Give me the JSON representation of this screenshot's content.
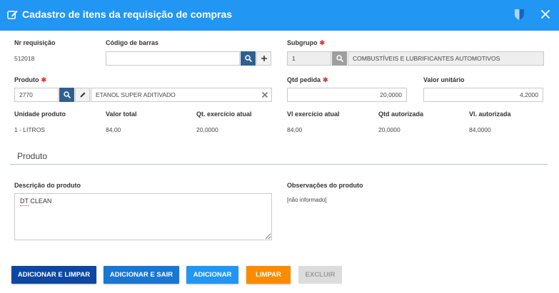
{
  "header": {
    "title": "Cadastro de itens da requisição de compras"
  },
  "form": {
    "nr_requisicao": {
      "label": "Nr requisição",
      "value": "512018"
    },
    "codigo_barras": {
      "label": "Código de barras",
      "value": ""
    },
    "subgrupo": {
      "label": "Subgrupo",
      "required": "✱",
      "code": "1",
      "description": "COMBUSTÍVEIS E LUBRIFICANTES AUTOMOTIVOS"
    },
    "produto": {
      "label": "Produto",
      "required": "✱",
      "code": "2770",
      "description": "ETANOL SUPER ADITIVADO"
    },
    "qtd_pedida": {
      "label": "Qtd pedida",
      "required": "✱",
      "value": "20,0000"
    },
    "valor_unitario": {
      "label": "Valor unitário",
      "value": "4,2000"
    },
    "unidade_produto": {
      "label": "Unidade produto",
      "value": "1 - LITROS"
    },
    "valor_total": {
      "label": "Valor total",
      "value": "84,00"
    },
    "qt_exercicio_atual": {
      "label": "Qt. exercício atual",
      "value": "20,0000"
    },
    "vl_exercicio_atual": {
      "label": "Vl exercício atual",
      "value": "84,00"
    },
    "qtd_autorizada": {
      "label": "Qtd autorizada",
      "value": "20,0000"
    },
    "vl_autorizada": {
      "label": "Vl. autorizada",
      "value": "84,0000"
    }
  },
  "section": {
    "title": "Produto",
    "descricao": {
      "label": "Descrição do produto",
      "value": "DT CLEAN"
    },
    "observacoes": {
      "label": "Observações do produto",
      "value": "[não informado]"
    }
  },
  "actions": {
    "adicionar_limpar": "ADICIONAR E LIMPAR",
    "adicionar_sair": "ADICIONAR E SAIR",
    "adicionar": "ADICIONAR",
    "limpar": "LIMPAR",
    "excluir": "EXCLUIR"
  },
  "colors": {
    "header": "#2196f3",
    "primary_dark": "#0d47a1",
    "primary": "#1976d2",
    "accent_orange": "#fb8c00",
    "required": "#e53935"
  },
  "icons": [
    "edit-icon",
    "shield-icon",
    "close-icon",
    "search-icon",
    "plus-icon",
    "pencil-icon",
    "clear-icon"
  ]
}
